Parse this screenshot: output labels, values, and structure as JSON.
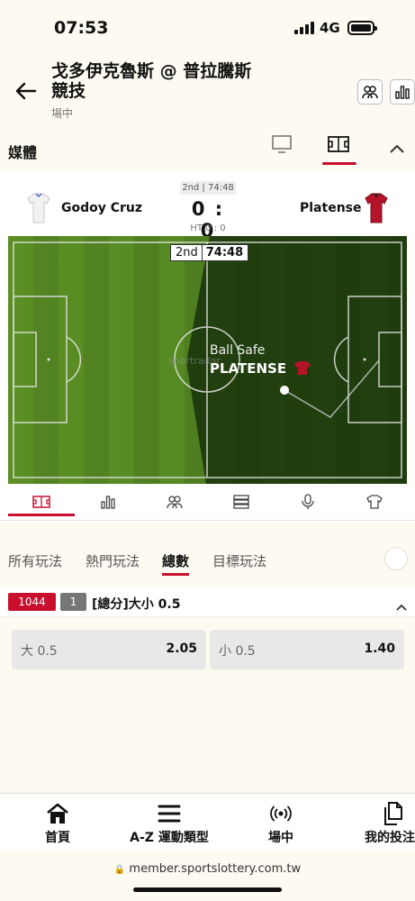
{
  "status_bar": {
    "time": "07:53",
    "network": "4G"
  },
  "header": {
    "title": "戈多伊克魯斯 @ 普拉騰斯競技",
    "subtitle": "場中"
  },
  "media": {
    "label": "媒體"
  },
  "match": {
    "period_chip": "2nd | 74:48",
    "home_team": "Godoy Cruz",
    "away_team": "Platense",
    "score": "0 : 0",
    "halftime": "HT 0 : 0"
  },
  "pitch": {
    "period": "2nd",
    "clock": "74:48",
    "event_label": "Ball Safe",
    "event_team": "PLATENSE",
    "watermark": "sportradar"
  },
  "pitch_tabs": [
    "pitch-icon",
    "stats-icon",
    "lineup-icon",
    "list-icon",
    "mic-icon",
    "shirt-icon"
  ],
  "market_tabs": [
    {
      "label": "所有玩法"
    },
    {
      "label": "熱門玩法"
    },
    {
      "label": "總數",
      "active": true
    },
    {
      "label": "目標玩法"
    }
  ],
  "market": {
    "id": "1044",
    "num": "1",
    "name": "[總分]大小 0.5",
    "options": [
      {
        "label": "大 0.5",
        "odds": "2.05"
      },
      {
        "label": "小 0.5",
        "odds": "1.40"
      }
    ]
  },
  "bottom_nav": [
    {
      "label": "首頁",
      "icon": "home-icon"
    },
    {
      "label": "A-Z 運動類型",
      "icon": "menu-icon"
    },
    {
      "label": "場中",
      "icon": "live-icon"
    },
    {
      "label": "我的投注",
      "icon": "bets-icon"
    }
  ],
  "browser": {
    "url": "member.sportslottery.com.tw"
  },
  "colors": {
    "accent": "#c8102e",
    "background": "#fdfaf1",
    "pitch_dark": "#1f4a12",
    "pitch_light": "#5b8f25"
  }
}
